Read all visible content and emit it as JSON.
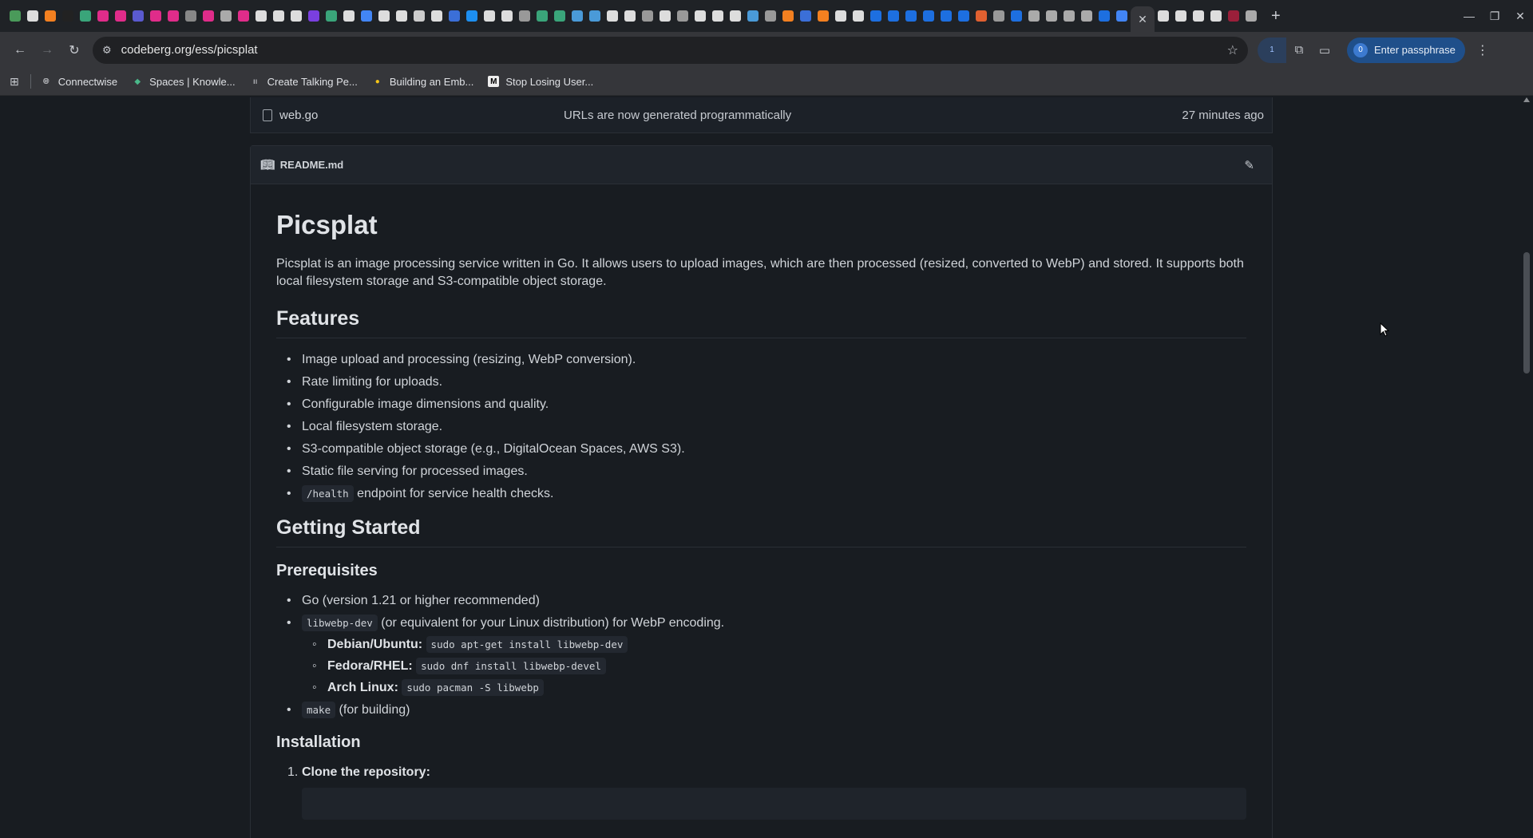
{
  "browser": {
    "url": "codeberg.org/ess/picsplat",
    "passphrase_button": "Enter passphrase",
    "passphrase_badge": "0",
    "extension_badge": "1",
    "bookmarks": [
      {
        "label": "Connectwise",
        "icon": "globe-icon"
      },
      {
        "label": "Spaces | Knowle...",
        "icon": "spaces-icon"
      },
      {
        "label": "Create Talking Pe...",
        "icon": "elevenlabs-icon"
      },
      {
        "label": "Building an Emb...",
        "icon": "lightbulb-icon"
      },
      {
        "label": "Stop Losing User...",
        "icon": "medium-icon"
      }
    ]
  },
  "file_row": {
    "name": "web.go",
    "commit_message": "URLs are now generated programmatically",
    "time": "27 minutes ago"
  },
  "readme": {
    "filename": "README.md",
    "title": "Picsplat",
    "intro": "Picsplat is an image processing service written in Go. It allows users to upload images, which are then processed (resized, converted to WebP) and stored. It supports both local filesystem storage and S3-compatible object storage.",
    "features_heading": "Features",
    "features": [
      "Image upload and processing (resizing, WebP conversion).",
      "Rate limiting for uploads.",
      "Configurable image dimensions and quality.",
      "Local filesystem storage.",
      "S3-compatible object storage (e.g., DigitalOcean Spaces, AWS S3).",
      "Static file serving for processed images."
    ],
    "health_code": "/health",
    "health_text": " endpoint for service health checks.",
    "getting_started_heading": "Getting Started",
    "prerequisites_heading": "Prerequisites",
    "prereq_go": "Go (version 1.21 or higher recommended)",
    "prereq_libwebp_code": "libwebp-dev",
    "prereq_libwebp_text": " (or equivalent for your Linux distribution) for WebP encoding.",
    "distros": [
      {
        "name": "Debian/Ubuntu:",
        "cmd": "sudo apt-get install libwebp-dev"
      },
      {
        "name": "Fedora/RHEL:",
        "cmd": "sudo dnf install libwebp-devel"
      },
      {
        "name": "Arch Linux:",
        "cmd": "sudo pacman -S libwebp"
      }
    ],
    "prereq_make_code": "make",
    "prereq_make_text": " (for building)",
    "installation_heading": "Installation",
    "install_step1": "Clone the repository:"
  }
}
